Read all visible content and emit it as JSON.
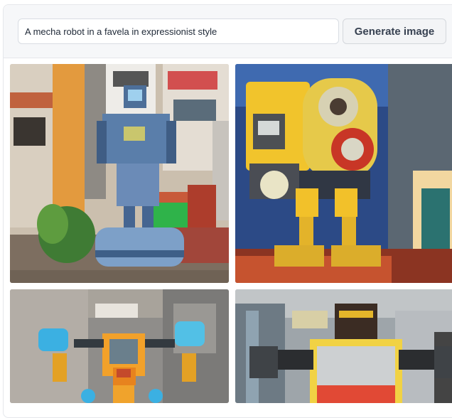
{
  "prompt": {
    "value": "A mecha robot in a favela in expressionist style"
  },
  "generate_button": {
    "label": "Generate image"
  },
  "gallery": {
    "images": [
      {
        "subject": "robot-on-car-in-favela-photo"
      },
      {
        "subject": "yellow-robot-expressionist-painting"
      },
      {
        "subject": "orange-robot-with-blue-fists"
      },
      {
        "subject": "graffiti-robot-on-wall"
      }
    ]
  }
}
